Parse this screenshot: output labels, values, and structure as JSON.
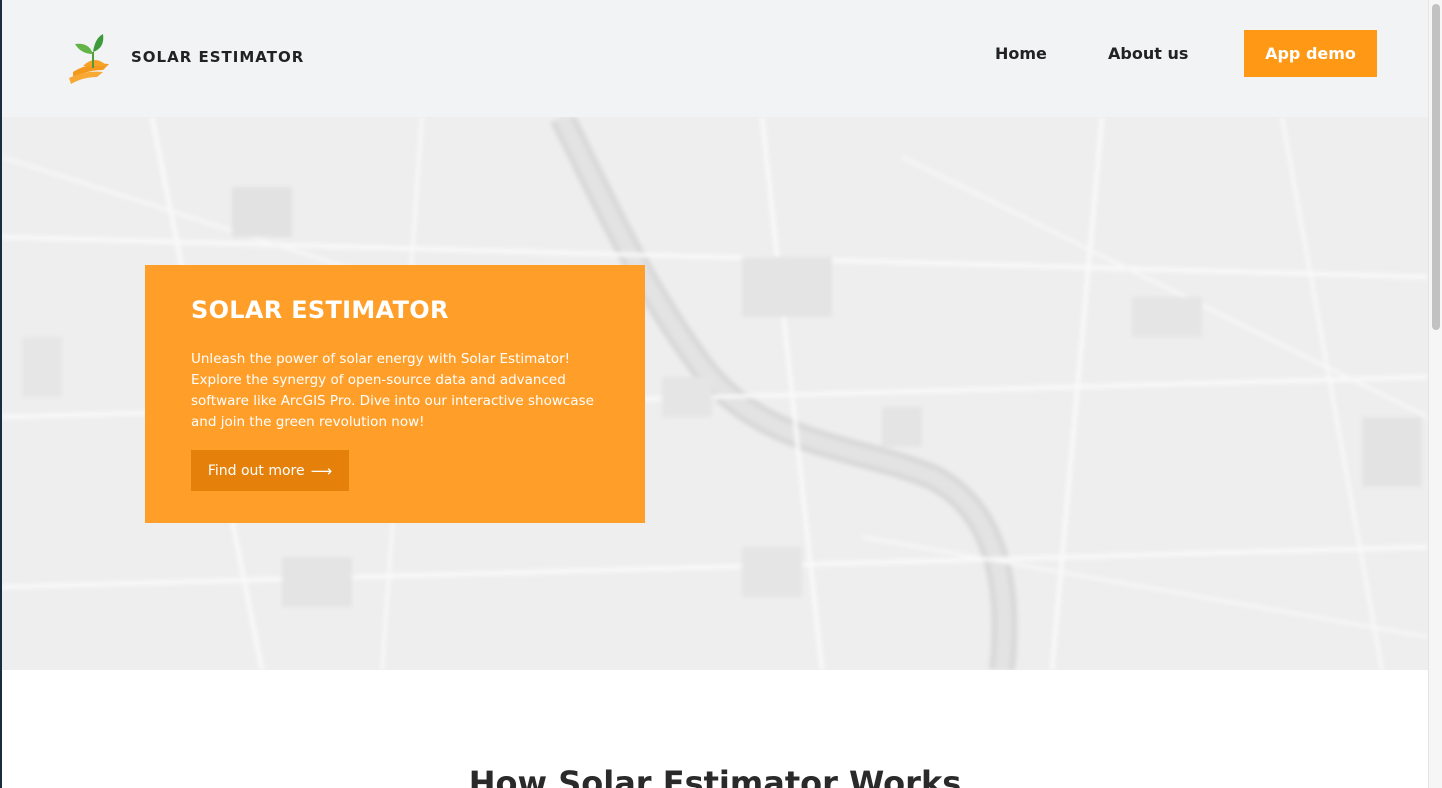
{
  "header": {
    "brand": "SOLAR ESTIMATOR",
    "logo_icon": "sprout-sun-logo-icon",
    "nav": {
      "home": "Home",
      "about": "About us",
      "demo": "App demo"
    }
  },
  "hero": {
    "background": "blurred-city-map",
    "title": "SOLAR ESTIMATOR",
    "description": "Unleash the power of solar energy with Solar Estimator! Explore the synergy of open-source data and advanced software like ArcGIS Pro. Dive into our interactive showcase and join the green revolution now!",
    "cta_label": "Find out more",
    "cta_icon": "arrow-right-icon"
  },
  "section": {
    "title": "How Solar Estimator Works"
  },
  "colors": {
    "accent": "#ff9814",
    "card": "#ff9f2a",
    "cta": "#e5810a",
    "header_bg": "#f2f3f5",
    "text_dark": "#222222"
  }
}
